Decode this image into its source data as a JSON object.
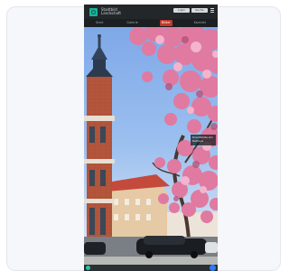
{
  "header": {
    "site_title": "Stadtbild Landschaft",
    "buttons": [
      "Login",
      "Suche"
    ]
  },
  "nav": {
    "items": [
      "Start",
      "Galerie",
      "Bilder",
      "Kontakt"
    ],
    "active_index": 2
  },
  "photo": {
    "caption": "Kirschblüte am Rathaus"
  },
  "colors": {
    "accent": "#19b39a",
    "nav_active": "#c1392b",
    "fab_right": "#2e7cf6"
  }
}
